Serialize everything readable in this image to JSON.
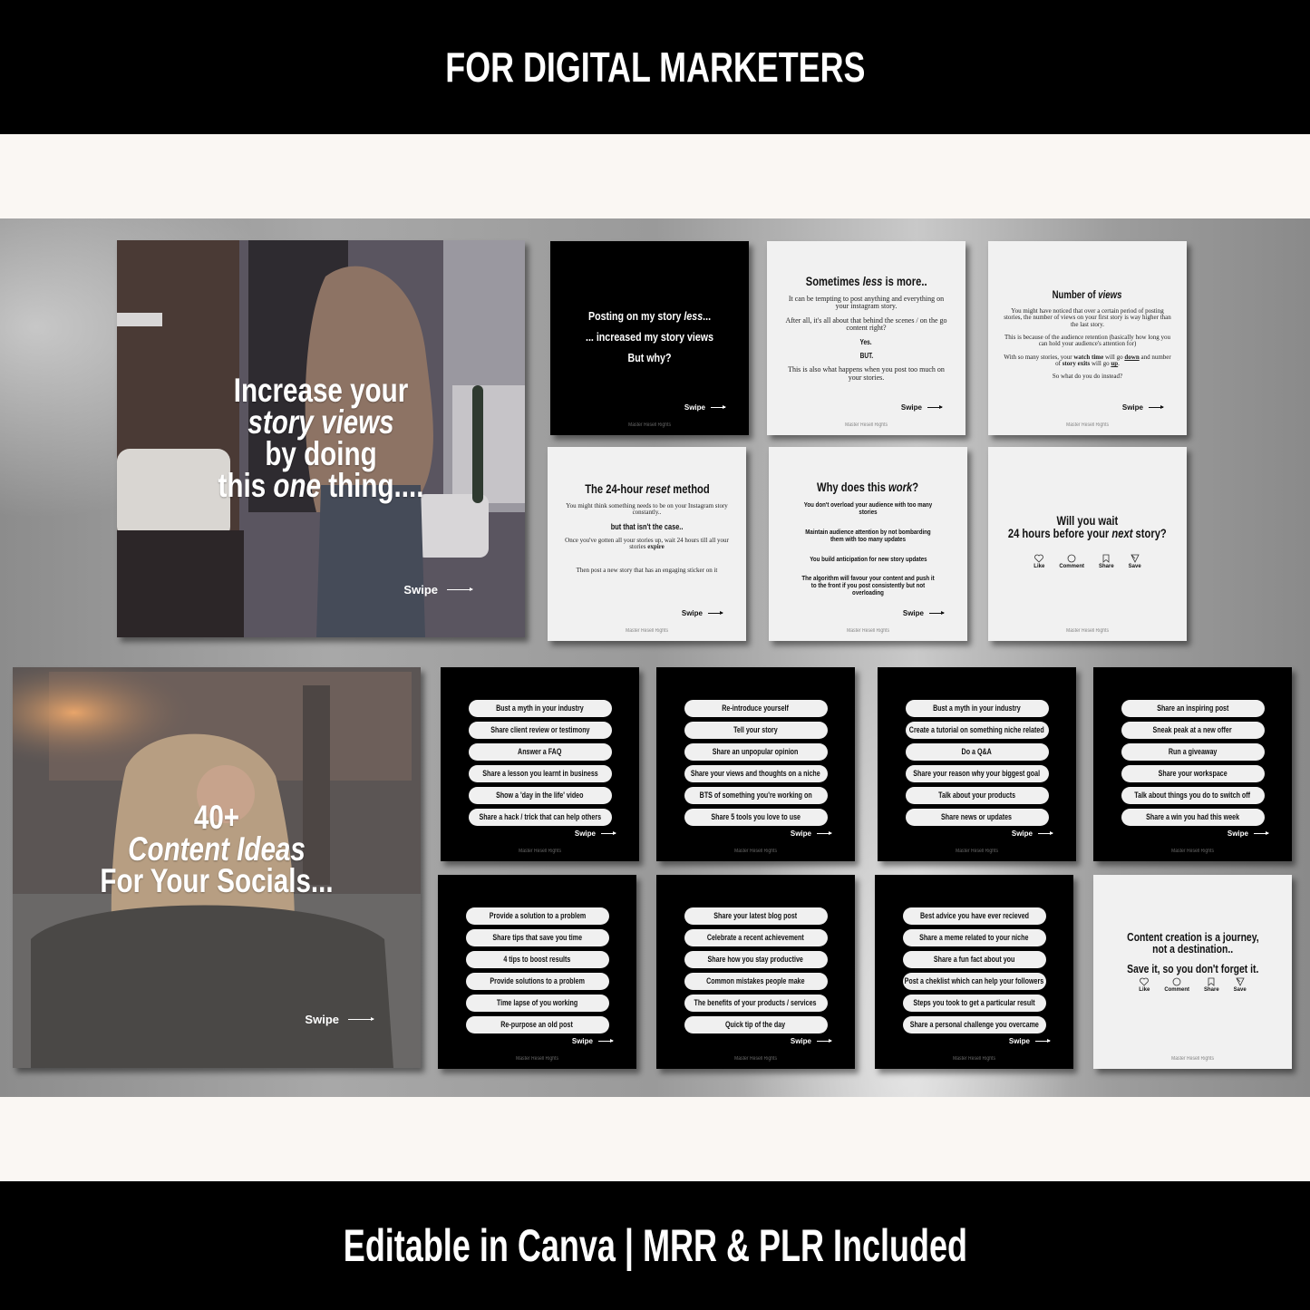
{
  "header": {
    "title": "FOR DIGITAL MARKETERS"
  },
  "footer": {
    "title": "Editable in Canva | MRR & PLR Included"
  },
  "common": {
    "swipe_label": "Swipe",
    "brand": "Master Resell Rights"
  },
  "colors": {
    "banner": "#000000",
    "cream": "#faf7f3",
    "card_white": "#f1f1f1",
    "card_black": "#000000"
  },
  "carousel1": {
    "cover": {
      "line1": "Increase your",
      "line2": "story views",
      "line3": "by doing",
      "line4_a": "this ",
      "line4_em": "one",
      "line4_b": " thing...."
    },
    "slide1": {
      "line1_a": "Posting on my story ",
      "line1_em": "less",
      "line1_b": "...",
      "line2": "... increased my story views",
      "line3": "But why?"
    },
    "slide2": {
      "title_a": "Sometimes ",
      "title_em": "less",
      "title_b": " is more..",
      "p1": "It can be tempting to post anything and everything on your instagram story.",
      "p2": "After all, it's all about that behind the scenes / on the go content right?",
      "p3": "Yes.",
      "p4": "BUT.",
      "p5": "This is also what happens when you post too much on your stories."
    },
    "slide3": {
      "title_a": "Number of ",
      "title_em": "views",
      "p1": "You might have noticed that over a certain period of posting stories, the number of views on your first story is way higher than the last story.",
      "p2": "This is because of the audience retention (basically how long you can hold your audience's attention for)",
      "p3_a": "With so many stories, your ",
      "p3_b1": "watch time",
      "p3_c": " will go ",
      "p3_b2": "down",
      "p3_d": " and number of ",
      "p3_b3": "story exits",
      "p3_e": " will go ",
      "p3_b4": "up",
      "p3_f": ".",
      "p4": "So what do you do instead?"
    },
    "slide4": {
      "title_a": "The 24-hour ",
      "title_em": "reset",
      "title_b": " method",
      "p1": "You might think something needs to be on your Instagram story constantly..",
      "p2": "but that isn't the case..",
      "p3_a": "Once you've gotten all your stories up, wait 24 hours till all your stories ",
      "p3_b": "expire",
      "p4": "Then post a new story that has an engaging sticker on it"
    },
    "slide5": {
      "title_a": "Why does this ",
      "title_em": "work",
      "title_b": "?",
      "points": [
        "You don't overload your audience with too many stories",
        "Maintain audience attention by not bombarding them with too many updates",
        "You build anticipation for new story updates",
        "The algorithm will favour your content and push it to the front if you post consistently but not overloading"
      ]
    },
    "slide6": {
      "line1": "Will you wait",
      "line2_a": "24 hours before your ",
      "line2_em": "next",
      "line2_b": " story?",
      "actions": [
        {
          "icon": "heart-icon",
          "label": "Like"
        },
        {
          "icon": "comment-icon",
          "label": "Comment"
        },
        {
          "icon": "bookmark-icon",
          "label": "Share"
        },
        {
          "icon": "send-icon",
          "label": "Save"
        }
      ]
    }
  },
  "carousel2": {
    "cover": {
      "line1": "40+",
      "line2": "Content Ideas",
      "line3": "For Your Socials..."
    },
    "idea_cards": [
      [
        "Bust a myth in your industry",
        "Share client review or testimony",
        "Answer a FAQ",
        "Share a lesson you learnt in business",
        "Show a 'day in the life' video",
        "Share a hack / trick that can help others"
      ],
      [
        "Re-introduce yourself",
        "Tell your story",
        "Share an unpopular opinion",
        "Share your views and thoughts on a niche",
        "BTS of something you're working on",
        "Share 5 tools you love to use"
      ],
      [
        "Bust a myth in your industry",
        "Create a tutorial on something niche related",
        "Do a Q&A",
        "Share your reason why your biggest goal",
        "Talk about your products",
        "Share news or updates"
      ],
      [
        "Share an inspiring post",
        "Sneak peak at a new offer",
        "Run a giveaway",
        "Share your workspace",
        "Talk about things you do to switch off",
        "Share a win you had this week"
      ],
      [
        "Provide a solution to a problem",
        "Share tips that save you time",
        "4 tips to boost results",
        "Provide solutions to a problem",
        "Time lapse of you working",
        "Re-purpose an old post"
      ],
      [
        "Share your latest blog post",
        "Celebrate a recent achievement",
        "Share how you stay productive",
        "Common mistakes people make",
        "The benefits of your products / services",
        "Quick tip of the day"
      ],
      [
        "Best advice you have ever recieved",
        "Share a meme related to your niche",
        "Share a fun fact about you",
        "Post a cheklist which can help your followers",
        "Steps you took to get a particular result",
        "Share a personal challenge you overcame"
      ]
    ],
    "closing": {
      "line1": "Content creation is a journey,",
      "line2": "not a destination..",
      "line3": "Save it, so you don't forget it.",
      "actions": [
        {
          "icon": "heart-icon",
          "label": "Like"
        },
        {
          "icon": "comment-icon",
          "label": "Comment"
        },
        {
          "icon": "bookmark-icon",
          "label": "Share"
        },
        {
          "icon": "send-icon",
          "label": "Save"
        }
      ]
    }
  }
}
